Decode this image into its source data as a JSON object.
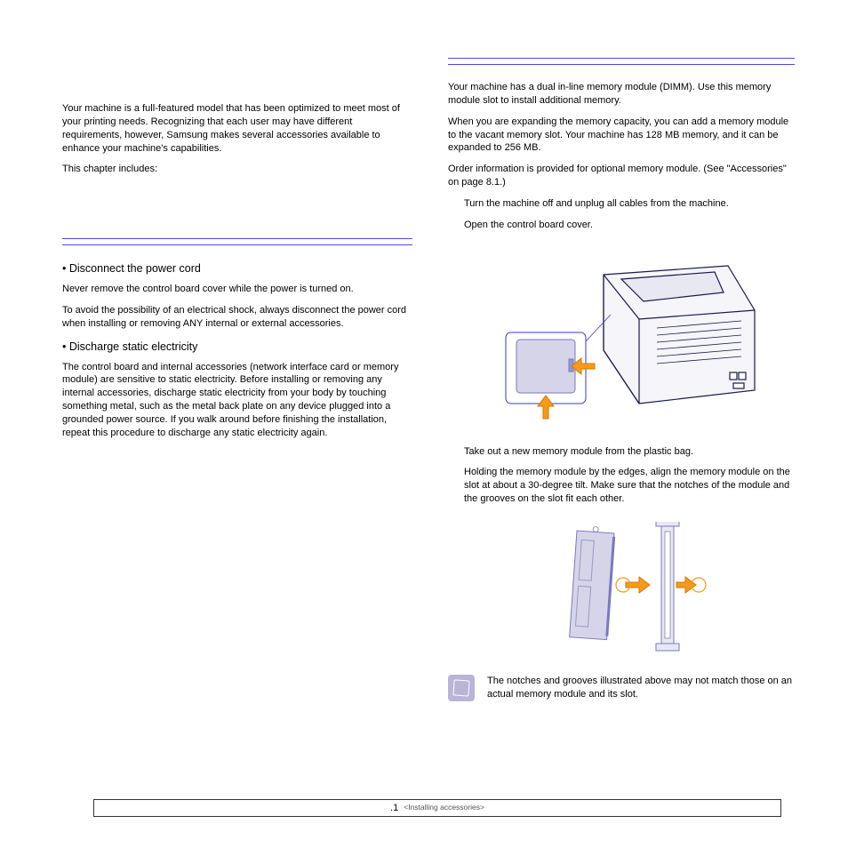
{
  "left": {
    "intro": "Your machine is a full-featured model that has been optimized to meet most of your printing needs. Recognizing that each user may have different requirements, however, Samsung makes several accessories available to enhance your machine's capabilities.",
    "chapter_includes": "This chapter includes:",
    "bullet1_title": "Disconnect the power cord",
    "bullet1_p1": "Never remove the control board cover while the power is turned on.",
    "bullet1_p2": "To avoid the possibility of an electrical shock, always disconnect the power cord when installing or removing ANY internal or external accessories.",
    "bullet2_title": "Discharge static electricity",
    "bullet2_p1": "The control board and internal accessories (network interface card or memory module) are sensitive to static electricity. Before installing or removing any internal accessories, discharge static electricity from your body by touching something metal, such as the metal back plate on any device plugged into a grounded power source. If you walk around before finishing the installation, repeat this procedure to discharge any static electricity again."
  },
  "right": {
    "p1": "Your machine has a dual in-line memory module (DIMM). Use this memory module slot to install additional memory.",
    "p2": "When you are expanding the memory capacity, you can add a memory module to the vacant memory slot. Your machine has 128 MB memory, and it can be expanded to 256 MB.",
    "p3": "Order information is provided for optional memory module. (See \"Accessories\" on page 8.1.)",
    "step1": "Turn the machine off and unplug all cables from the machine.",
    "step2": "Open the control board cover.",
    "step3": "Take out a new memory module from the plastic bag.",
    "step4": "Holding the memory module by the edges, align the memory module on the slot at about a 30-degree tilt. Make sure that the notches of the module and the grooves on the slot fit each other.",
    "note": "The notches and grooves illustrated above may not match those on an actual memory module and its slot."
  },
  "footer": {
    "page": ".1",
    "chapter": "<Installing accessories>"
  }
}
